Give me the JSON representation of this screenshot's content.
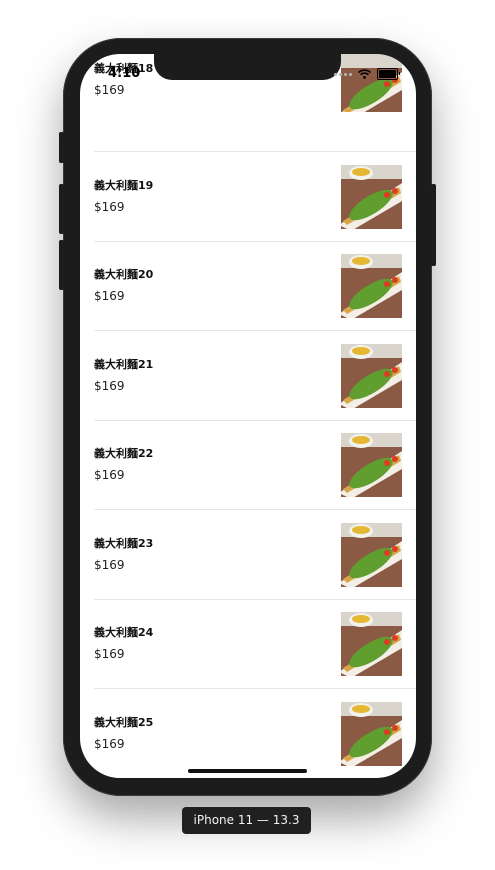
{
  "status_bar": {
    "time": "4:10"
  },
  "items": [
    {
      "name": "義大利麵18",
      "price": "$169"
    },
    {
      "name": "義大利麵19",
      "price": "$169"
    },
    {
      "name": "義大利麵20",
      "price": "$169"
    },
    {
      "name": "義大利麵21",
      "price": "$169"
    },
    {
      "name": "義大利麵22",
      "price": "$169"
    },
    {
      "name": "義大利麵23",
      "price": "$169"
    },
    {
      "name": "義大利麵24",
      "price": "$169"
    },
    {
      "name": "義大利麵25",
      "price": "$169"
    }
  ],
  "device_label": "iPhone 11 — 13.3",
  "colors": {
    "phone_body": "#1c1c1c",
    "separator": "#e6e6e6"
  },
  "icons": [
    "wifi-icon",
    "battery-icon",
    "signal-dots-icon"
  ]
}
